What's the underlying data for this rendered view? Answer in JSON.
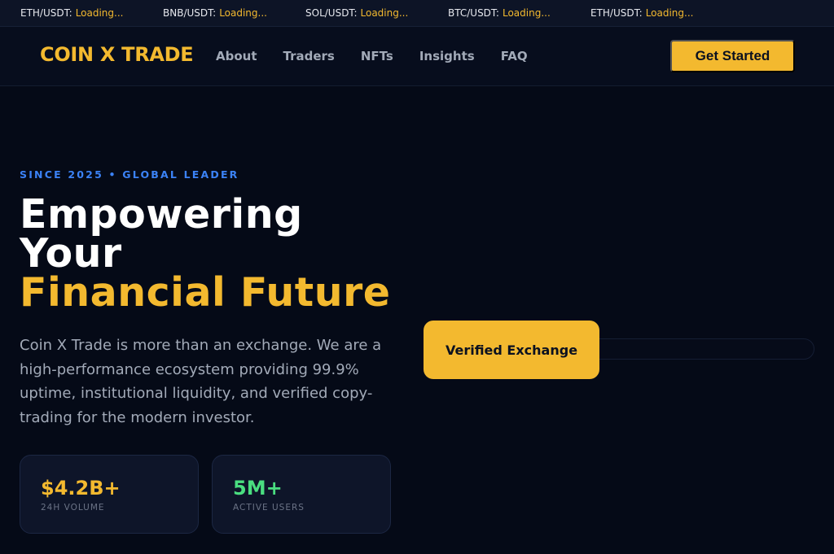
{
  "ticker": [
    {
      "pair": "ETH/USDT:",
      "value": "Loading..."
    },
    {
      "pair": "BNB/USDT:",
      "value": "Loading..."
    },
    {
      "pair": "SOL/USDT:",
      "value": "Loading..."
    },
    {
      "pair": "BTC/USDT:",
      "value": "Loading..."
    },
    {
      "pair": "ETH/USDT:",
      "value": "Loading..."
    }
  ],
  "header": {
    "brand": "COIN X TRADE",
    "nav": [
      "About",
      "Traders",
      "NFTs",
      "Insights",
      "FAQ"
    ],
    "cta_label": "Get Started"
  },
  "hero": {
    "eyebrow": "SINCE 2025 • GLOBAL LEADER",
    "headline_line1": "Empowering",
    "headline_line2": "Your",
    "headline_accent": "Financial Future",
    "lead": "Coin X Trade is more than an exchange. We are a high-performance ecosystem providing 99.9% uptime, institutional liquidity, and verified copy-trading for the modern investor.",
    "stats": [
      {
        "value": "$4.2B+",
        "label": "24H VOLUME",
        "color": "#f3b92f"
      },
      {
        "value": "5M+",
        "label": "ACTIVE USERS",
        "color": "#4ade80"
      }
    ],
    "badge": "Verified Exchange"
  },
  "colors": {
    "accent": "#f3b92f",
    "eyebrow": "#3b82f6",
    "background": "#050a17"
  }
}
